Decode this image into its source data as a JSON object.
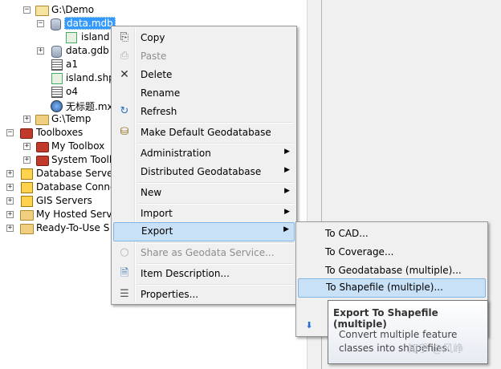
{
  "tree": {
    "items": [
      {
        "label": "G:\\Demo",
        "icon": "folder-open-icon"
      },
      {
        "label": "data.mdb",
        "icon": "personal-geodatabase-icon"
      },
      {
        "label": "island",
        "icon": "feature-class-icon"
      },
      {
        "label": "data.gdb",
        "icon": "file-geodatabase-icon"
      },
      {
        "label": "a1",
        "icon": "table-icon"
      },
      {
        "label": "island.shp",
        "icon": "shapefile-icon"
      },
      {
        "label": "o4",
        "icon": "table-icon"
      },
      {
        "label": "无标题.mx",
        "icon": "map-document-icon"
      },
      {
        "label": "G:\\Temp",
        "icon": "folder-icon"
      },
      {
        "label": "Toolboxes",
        "icon": "toolboxes-icon"
      },
      {
        "label": "My Toolbox",
        "icon": "toolbox-icon"
      },
      {
        "label": "System Tooll",
        "icon": "toolbox-icon"
      },
      {
        "label": "Database Server",
        "icon": "database-server-icon"
      },
      {
        "label": "Database Conne",
        "icon": "database-connection-icon"
      },
      {
        "label": "GIS Servers",
        "icon": "gis-server-icon"
      },
      {
        "label": "My Hosted Serv",
        "icon": "hosted-services-icon"
      },
      {
        "label": "Ready-To-Use S",
        "icon": "ready-to-use-icon"
      }
    ]
  },
  "context_menu": {
    "items": [
      {
        "label": "Copy",
        "icon": "copy-icon",
        "enabled": true
      },
      {
        "label": "Paste",
        "icon": "paste-icon",
        "enabled": false
      },
      {
        "label": "Delete",
        "icon": "delete-icon",
        "enabled": true
      },
      {
        "label": "Rename",
        "enabled": true
      },
      {
        "label": "Refresh",
        "icon": "refresh-icon",
        "enabled": true
      },
      {
        "label": "Make Default Geodatabase",
        "icon": "default-geodatabase-icon",
        "enabled": true
      },
      {
        "label": "Administration",
        "submenu": true,
        "enabled": true
      },
      {
        "label": "Distributed Geodatabase",
        "submenu": true,
        "enabled": true
      },
      {
        "label": "New",
        "submenu": true,
        "enabled": true
      },
      {
        "label": "Import",
        "submenu": true,
        "enabled": true
      },
      {
        "label": "Export",
        "submenu": true,
        "enabled": true,
        "highlighted": true
      },
      {
        "label": "Share as Geodata Service...",
        "icon": "share-icon",
        "enabled": false
      },
      {
        "label": "Item Description...",
        "icon": "description-icon",
        "enabled": true
      },
      {
        "label": "Properties...",
        "icon": "properties-icon",
        "enabled": true
      }
    ]
  },
  "export_submenu": {
    "items": [
      {
        "label": "To CAD..."
      },
      {
        "label": "To Coverage..."
      },
      {
        "label": "To Geodatabase (multiple)..."
      },
      {
        "label": "To Shapefile (multiple)...",
        "highlighted": true
      }
    ]
  },
  "tooltip": {
    "title": "Export To Shapefile (multiple)",
    "body": "Convert multiple feature classes into shapefiles."
  },
  "watermark": "知乎 @风峥",
  "colors": {
    "selection": "#3399ff",
    "menu_background": "#f0f0f0",
    "menu_hover": "#c9e1f7"
  }
}
